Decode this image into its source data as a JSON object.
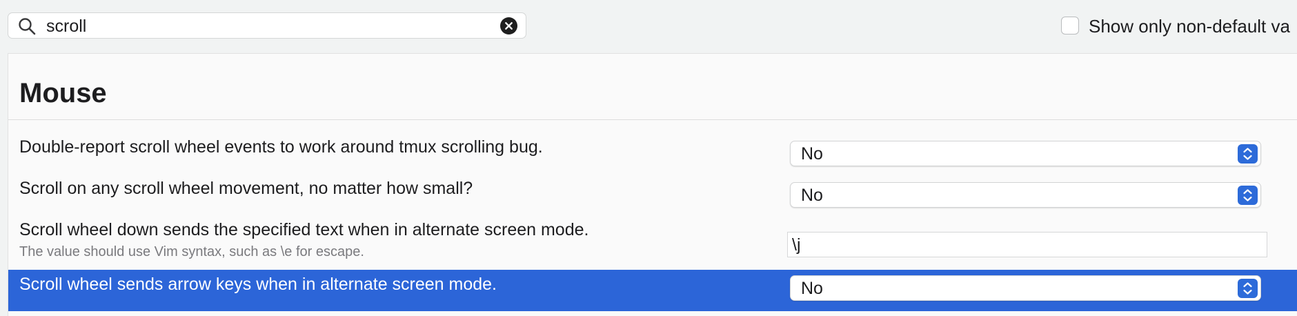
{
  "search": {
    "value": "scroll",
    "icon": "magnifying-glass",
    "clear_icon": "x-circle-filled"
  },
  "filter": {
    "label": "Show only non-default va",
    "checked": false
  },
  "section": {
    "title": "Mouse"
  },
  "settings": [
    {
      "label": "Double-report scroll wheel events to work around tmux scrolling bug.",
      "control": "popup",
      "value": "No"
    },
    {
      "label": "Scroll on any scroll wheel movement, no matter how small?",
      "control": "popup",
      "value": "No"
    },
    {
      "label": "Scroll wheel down sends the specified text when in alternate screen mode.",
      "sublabel": "The value should use Vim syntax, such as \\e for escape.",
      "control": "text",
      "value": "\\j"
    },
    {
      "label": "Scroll wheel sends arrow keys when in alternate screen mode.",
      "control": "popup",
      "value": "No",
      "selected": true
    }
  ],
  "colors": {
    "selection": "#2c65d8",
    "stepper": "#2d6bd9",
    "window_bg": "#f1f3f3",
    "panel_bg": "#fafafa"
  }
}
